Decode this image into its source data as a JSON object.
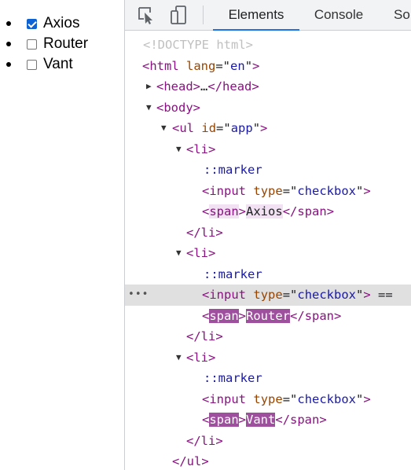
{
  "page_preview": {
    "items": [
      {
        "label": "Axios",
        "checked": true
      },
      {
        "label": "Router",
        "checked": false
      },
      {
        "label": "Vant",
        "checked": false
      }
    ]
  },
  "devtools": {
    "tabs": {
      "elements": "Elements",
      "console": "Console",
      "sources": "So"
    },
    "toolbar": {
      "inspect_icon": "inspect-element-icon",
      "device_icon": "device-toggle-icon"
    },
    "tree": {
      "doctype": "<!DOCTYPE html>",
      "html_open": {
        "tag": "html",
        "attr": "lang",
        "val": "en"
      },
      "head": {
        "open": "head",
        "ellipsis": "…",
        "close": "/head"
      },
      "body": "body",
      "ul": {
        "tag": "ul",
        "attr": "id",
        "val": "app"
      },
      "li": "li",
      "li_close": "/li",
      "marker": "::marker",
      "input": {
        "tag": "input",
        "attr": "type",
        "val": "checkbox"
      },
      "span": "span",
      "span_close": "/span",
      "span_texts": [
        "Axios",
        "Router",
        "Vant"
      ],
      "ul_close": "/ul",
      "selected_suffix": "==",
      "selected_dots": "•••"
    }
  },
  "colors": {
    "tag": "#881280",
    "attr": "#994500",
    "value": "#1a1aa6",
    "selection": "#e0e0e0",
    "accent": "#1a73e8"
  }
}
